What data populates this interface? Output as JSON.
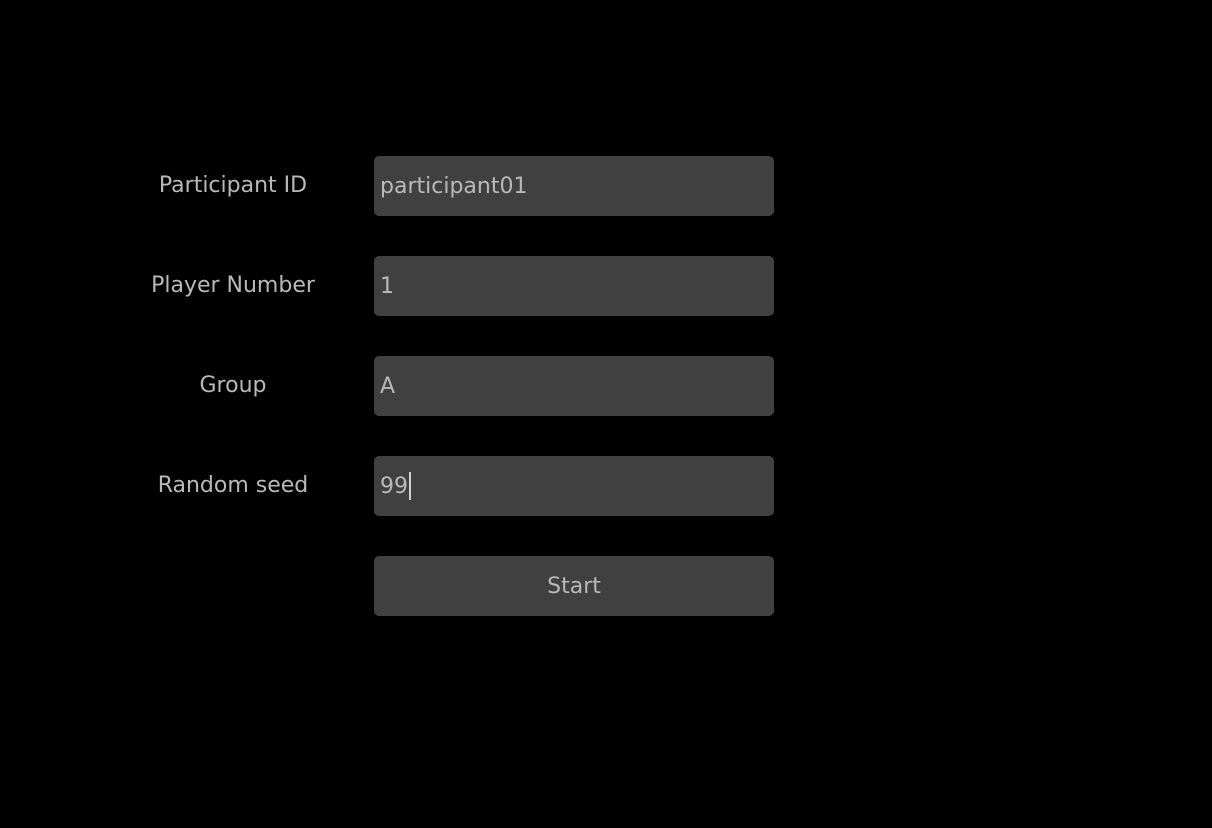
{
  "form": {
    "participant_id": {
      "label": "Participant ID",
      "value": "participant01"
    },
    "player_number": {
      "label": "Player Number",
      "value": "1"
    },
    "group": {
      "label": "Group",
      "value": "A"
    },
    "random_seed": {
      "label": "Random seed",
      "value": "99"
    },
    "start_label": "Start"
  },
  "colors": {
    "background": "#000000",
    "field_background": "#404040",
    "text": "#b9b9b9"
  }
}
